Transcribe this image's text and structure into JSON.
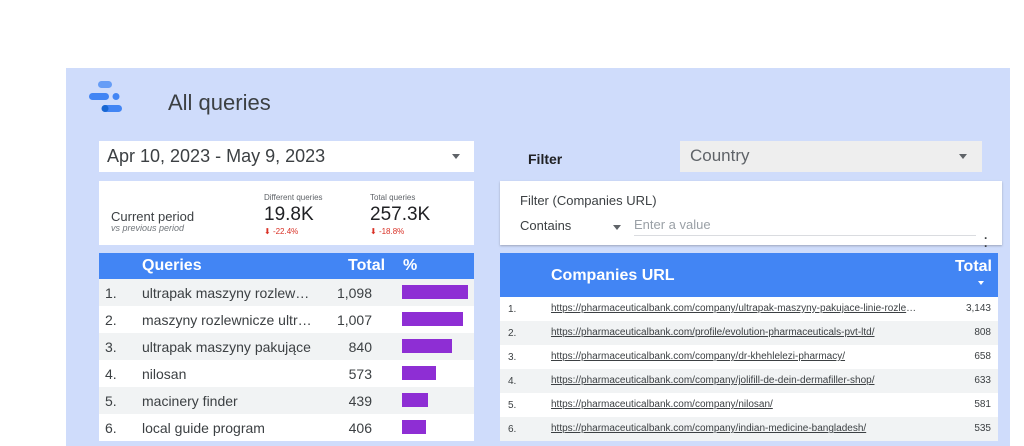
{
  "header": {
    "title": "All queries"
  },
  "date_range": {
    "value": "Apr 10, 2023 - May 9, 2023"
  },
  "scorecard": {
    "label": "Current period",
    "sublabel": "vs previous period",
    "metrics": [
      {
        "label": "Different queries",
        "value": "19.8K",
        "delta": "-22.4%"
      },
      {
        "label": "Total queries",
        "value": "257.3K",
        "delta": "-18.8%"
      }
    ]
  },
  "queries_table": {
    "headers": {
      "query": "Queries",
      "total": "Total",
      "pct": "%"
    },
    "rows": [
      {
        "num": "1.",
        "query": "ultrapak maszyny rozlewnicze",
        "total": "1,098",
        "pct": 1.0
      },
      {
        "num": "2.",
        "query": "maszyny rozlewnicze ultrapak",
        "total": "1,007",
        "pct": 0.917
      },
      {
        "num": "3.",
        "query": "ultrapak maszyny pakujące",
        "total": "840",
        "pct": 0.765
      },
      {
        "num": "4.",
        "query": "nilosan",
        "total": "573",
        "pct": 0.522
      },
      {
        "num": "5.",
        "query": "macinery finder",
        "total": "439",
        "pct": 0.4
      },
      {
        "num": "6.",
        "query": "local guide program",
        "total": "406",
        "pct": 0.37
      }
    ],
    "bar_color": "#8e2ed4"
  },
  "country_filter": {
    "label": "Filter",
    "value": "Country"
  },
  "url_filter": {
    "title": "Filter (Companies URL)",
    "operator": "Contains",
    "placeholder": "Enter a value"
  },
  "urls_table": {
    "headers": {
      "url": "Companies URL",
      "total": "Total"
    },
    "rows": [
      {
        "num": "1.",
        "url": "https://pharmaceuticalbank.com/company/ultrapak-maszyny-pakujace-linie-rozlewnicze/",
        "total": "3,143"
      },
      {
        "num": "2.",
        "url": "https://pharmaceuticalbank.com/profile/evolution-pharmaceuticals-pvt-ltd/",
        "total": "808"
      },
      {
        "num": "3.",
        "url": "https://pharmaceuticalbank.com/company/dr-khehlelezi-pharmacy/",
        "total": "658"
      },
      {
        "num": "4.",
        "url": "https://pharmaceuticalbank.com/company/jolifill-de-dein-dermafiller-shop/",
        "total": "633"
      },
      {
        "num": "5.",
        "url": "https://pharmaceuticalbank.com/company/nilosan/",
        "total": "581"
      },
      {
        "num": "6.",
        "url": "https://pharmaceuticalbank.com/company/indian-medicine-bangladesh/",
        "total": "535"
      }
    ]
  },
  "colors": {
    "canvas_bg": "#cfdcfb",
    "header_blue": "#4285f4",
    "delta_red": "#d93025"
  }
}
